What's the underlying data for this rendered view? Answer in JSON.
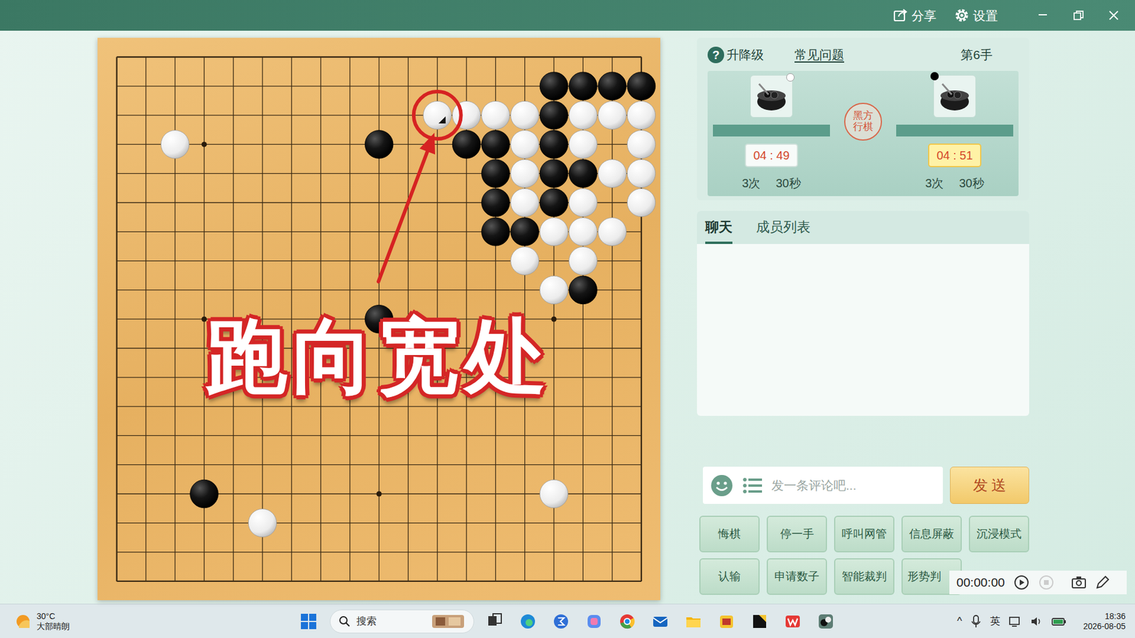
{
  "window": {
    "actions": [
      {
        "label": "分享",
        "kind": "share"
      },
      {
        "label": "设置",
        "kind": "gear"
      }
    ]
  },
  "board": {
    "size": 19,
    "stones": [
      {
        "col": 15,
        "row": 1,
        "kind": "black"
      },
      {
        "col": 16,
        "row": 1,
        "kind": "black"
      },
      {
        "col": 17,
        "row": 1,
        "kind": "black"
      },
      {
        "col": 18,
        "row": 1,
        "kind": "black"
      },
      {
        "col": 11,
        "row": 2,
        "kind": "white"
      },
      {
        "col": 12,
        "row": 2,
        "kind": "white"
      },
      {
        "col": 13,
        "row": 2,
        "kind": "white"
      },
      {
        "col": 14,
        "row": 2,
        "kind": "white"
      },
      {
        "col": 15,
        "row": 2,
        "kind": "black"
      },
      {
        "col": 16,
        "row": 2,
        "kind": "white"
      },
      {
        "col": 17,
        "row": 2,
        "kind": "white"
      },
      {
        "col": 18,
        "row": 2,
        "kind": "white"
      },
      {
        "col": 2,
        "row": 3,
        "kind": "white"
      },
      {
        "col": 9,
        "row": 3,
        "kind": "black"
      },
      {
        "col": 12,
        "row": 3,
        "kind": "black"
      },
      {
        "col": 13,
        "row": 3,
        "kind": "black"
      },
      {
        "col": 14,
        "row": 3,
        "kind": "white"
      },
      {
        "col": 15,
        "row": 3,
        "kind": "black"
      },
      {
        "col": 16,
        "row": 3,
        "kind": "white"
      },
      {
        "col": 18,
        "row": 3,
        "kind": "white"
      },
      {
        "col": 13,
        "row": 4,
        "kind": "black"
      },
      {
        "col": 14,
        "row": 4,
        "kind": "white"
      },
      {
        "col": 15,
        "row": 4,
        "kind": "black"
      },
      {
        "col": 16,
        "row": 4,
        "kind": "black"
      },
      {
        "col": 17,
        "row": 4,
        "kind": "white"
      },
      {
        "col": 18,
        "row": 4,
        "kind": "white"
      },
      {
        "col": 13,
        "row": 5,
        "kind": "black"
      },
      {
        "col": 14,
        "row": 5,
        "kind": "white"
      },
      {
        "col": 15,
        "row": 5,
        "kind": "black"
      },
      {
        "col": 16,
        "row": 5,
        "kind": "white"
      },
      {
        "col": 18,
        "row": 5,
        "kind": "white"
      },
      {
        "col": 13,
        "row": 6,
        "kind": "black"
      },
      {
        "col": 14,
        "row": 6,
        "kind": "black"
      },
      {
        "col": 15,
        "row": 6,
        "kind": "white"
      },
      {
        "col": 16,
        "row": 6,
        "kind": "white"
      },
      {
        "col": 17,
        "row": 6,
        "kind": "white"
      },
      {
        "col": 14,
        "row": 7,
        "kind": "white"
      },
      {
        "col": 16,
        "row": 7,
        "kind": "white"
      },
      {
        "col": 15,
        "row": 8,
        "kind": "white"
      },
      {
        "col": 16,
        "row": 8,
        "kind": "black"
      },
      {
        "col": 9,
        "row": 9,
        "kind": "black"
      },
      {
        "col": 3,
        "row": 15,
        "kind": "black"
      },
      {
        "col": 15,
        "row": 15,
        "kind": "white"
      },
      {
        "col": 5,
        "row": 16,
        "kind": "white"
      }
    ],
    "last_move": {
      "col": 11,
      "row": 2
    },
    "annotation": {
      "caption": "跑向宽处",
      "circle": {
        "col": 11,
        "row": 2
      },
      "arrow": {
        "from": [
          8.98,
          7.71
        ],
        "to": [
          10.9,
          2.6
        ]
      }
    }
  },
  "game_panel": {
    "help": "?",
    "rank": "升降级",
    "faq": "常见问题",
    "move": "第6手",
    "turn": "黑方行棋",
    "players": [
      {
        "stone": "white",
        "time": "04 : 49",
        "periods": "3次",
        "period_time": "30秒",
        "selected": false
      },
      {
        "stone": "black",
        "time": "04 : 51",
        "periods": "3次",
        "period_time": "30秒",
        "selected": true
      }
    ]
  },
  "chat": {
    "tabs": [
      {
        "label": "聊天",
        "selected": true
      },
      {
        "label": "成员列表",
        "selected": false
      }
    ],
    "placeholder": "发一条评论吧...",
    "send": "发 送"
  },
  "actions": [
    [
      "悔棋",
      "停一手",
      "呼叫网管",
      "信息屏蔽",
      "沉浸模式"
    ],
    [
      "认输",
      "申请数子",
      "智能裁判",
      "形势判"
    ]
  ],
  "recorder": {
    "time": "00:00:00"
  },
  "taskbar": {
    "weather": {
      "temp": "30°C",
      "desc": "大部晴朗"
    },
    "search": "搜索",
    "tray": {
      "chevron": "^",
      "ime": "英"
    },
    "clock": {
      "time": "18:36",
      "date": "2026-08-05"
    }
  }
}
